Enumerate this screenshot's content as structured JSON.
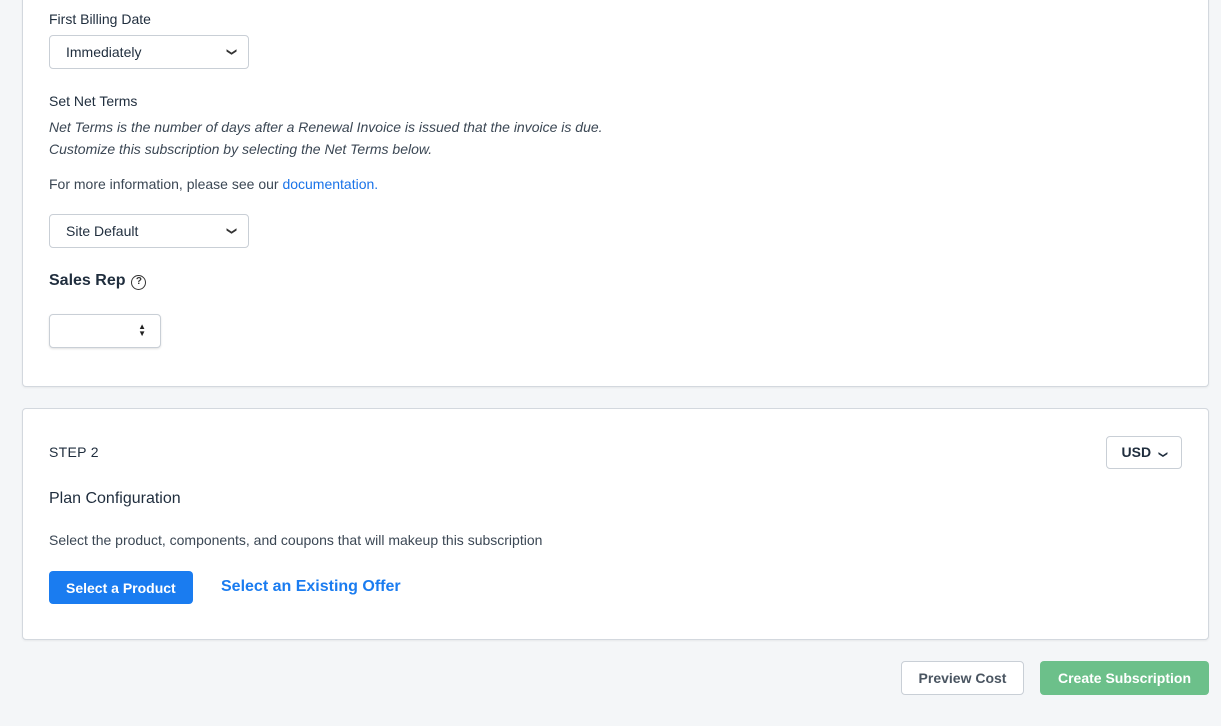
{
  "billing": {
    "first_billing_label": "First Billing Date",
    "first_billing_value": "Immediately",
    "net_terms_label": "Set Net Terms",
    "net_terms_desc_line1": "Net Terms is the number of days after a Renewal Invoice is issued that the invoice is due.",
    "net_terms_desc_line2": "Customize this subscription by selecting the Net Terms below.",
    "info_prefix": "For more information, please see our ",
    "info_link": "documentation",
    "info_suffix": ".",
    "net_terms_value": "Site Default",
    "sales_rep_label": "Sales Rep",
    "sales_rep_value": ""
  },
  "step2": {
    "step_label": "STEP 2",
    "currency": "USD",
    "title": "Plan Configuration",
    "description": "Select the product, components, and coupons that will makeup this subscription",
    "select_product_label": "Select a Product",
    "select_offer_label": "Select an Existing Offer"
  },
  "footer": {
    "preview_label": "Preview Cost",
    "create_label": "Create Subscription"
  },
  "colors": {
    "primary": "#1a7cf0",
    "success": "#6cc08a",
    "link": "#1a73e8"
  }
}
